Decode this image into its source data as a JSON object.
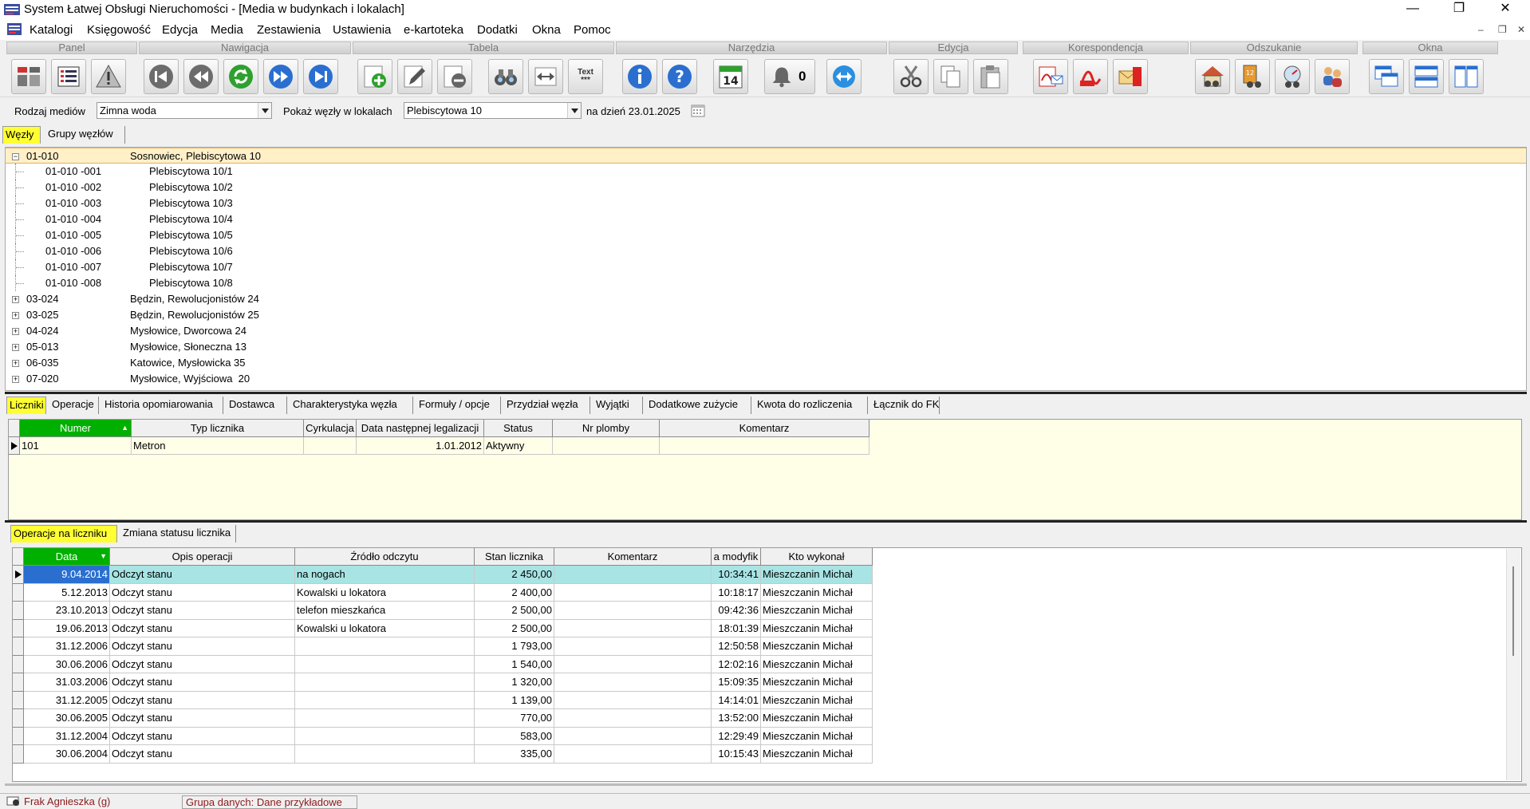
{
  "window": {
    "title": "System Łatwej Obsługi Nieruchomości - [Media w budynkach i lokalach]",
    "minimize": "—",
    "maximize": "❐",
    "close": "✕",
    "mdi_min": "–",
    "mdi_restore": "❐",
    "mdi_close": "✕"
  },
  "menu": [
    "Katalogi",
    "Księgowość",
    "Edycja",
    "Media",
    "Zestawienia",
    "Ustawienia",
    "e-kartoteka",
    "Dodatki",
    "Okna",
    "Pomoc"
  ],
  "toolbar": {
    "groups": [
      "Panel",
      "Nawigacja",
      "Tabela",
      "Narzędzia",
      "Edycja",
      "Korespondencja",
      "Odszukanie",
      "Okna"
    ],
    "text_button_label": "Text",
    "text_button_sub": "***",
    "calendar_day": "14",
    "bell_count": "0"
  },
  "filter": {
    "media_label": "Rodzaj mediów",
    "media_value": "Zimna woda",
    "show_label": "Pokaż węzły w lokalach",
    "show_value": "Plebiscytowa 10",
    "date_label": "na dzień 23.01.2025"
  },
  "tree_tabs": [
    "Węzły",
    "Grupy węzłów"
  ],
  "tree": [
    {
      "code": "01-010",
      "name": "Sosnowiec, Plebiscytowa 10",
      "level": 0,
      "expander": "−",
      "selected": true
    },
    {
      "code": "01-010 -001",
      "name": "Plebiscytowa 10/1",
      "level": 1
    },
    {
      "code": "01-010 -002",
      "name": "Plebiscytowa 10/2",
      "level": 1
    },
    {
      "code": "01-010 -003",
      "name": "Plebiscytowa 10/3",
      "level": 1
    },
    {
      "code": "01-010 -004",
      "name": "Plebiscytowa 10/4",
      "level": 1
    },
    {
      "code": "01-010 -005",
      "name": "Plebiscytowa 10/5",
      "level": 1
    },
    {
      "code": "01-010 -006",
      "name": "Plebiscytowa 10/6",
      "level": 1
    },
    {
      "code": "01-010 -007",
      "name": "Plebiscytowa 10/7",
      "level": 1
    },
    {
      "code": "01-010 -008",
      "name": "Plebiscytowa 10/8",
      "level": 1
    },
    {
      "code": "03-024",
      "name": "Będzin, Rewolucjonistów 24",
      "level": 0,
      "expander": "+"
    },
    {
      "code": "03-025",
      "name": "Będzin, Rewolucjonistów 25",
      "level": 0,
      "expander": "+"
    },
    {
      "code": "04-024",
      "name": "Mysłowice, Dworcowa 24",
      "level": 0,
      "expander": "+"
    },
    {
      "code": "05-013",
      "name": "Mysłowice, Słoneczna 13",
      "level": 0,
      "expander": "+"
    },
    {
      "code": "06-035",
      "name": "Katowice, Mysłowicka 35",
      "level": 0,
      "expander": "+"
    },
    {
      "code": "07-020",
      "name": "Mysłowice, Wyjściowa  20",
      "level": 0,
      "expander": "+"
    }
  ],
  "detail_tabs": [
    "Liczniki",
    "Operacje",
    "Historia opomiarowania",
    "Dostawca",
    "Charakterystyka węzła",
    "Formuły / opcje",
    "Przydział węzła",
    "Wyjątki",
    "Dodatkowe zużycie",
    "Kwota do rozliczenia",
    "Łącznik do FK"
  ],
  "meters": {
    "columns": [
      "Numer",
      "Typ licznika",
      "Cyrkulacja",
      "Data następnej legalizacji",
      "Status",
      "Nr plomby",
      "Komentarz"
    ],
    "sort_arrow": "▲",
    "rows": [
      [
        "101",
        "Metron",
        "",
        "1.01.2012",
        "Aktywny",
        "",
        ""
      ]
    ]
  },
  "ops_tabs": [
    "Operacje na liczniku",
    "Zmiana statusu licznika"
  ],
  "operations": {
    "columns": [
      "Data",
      "Opis operacji",
      "Źródło odczytu",
      "Stan licznika",
      "Komentarz",
      "a modyfik",
      "Kto wykonał"
    ],
    "sort_arrow": "▼",
    "rows": [
      [
        "9.04.2014",
        "Odczyt stanu",
        "na nogach",
        "2 450,00",
        "",
        "10:34:41",
        "Mieszczanin Michał"
      ],
      [
        "5.12.2013",
        "Odczyt stanu",
        "Kowalski u lokatora",
        "2 400,00",
        "",
        "10:18:17",
        "Mieszczanin Michał"
      ],
      [
        "23.10.2013",
        "Odczyt stanu",
        "telefon mieszkańca",
        "2 500,00",
        "",
        "09:42:36",
        "Mieszczanin Michał"
      ],
      [
        "19.06.2013",
        "Odczyt stanu",
        "Kowalski u lokatora",
        "2 500,00",
        "",
        "18:01:39",
        "Mieszczanin Michał"
      ],
      [
        "31.12.2006",
        "Odczyt stanu",
        "",
        "1 793,00",
        "",
        "12:50:58",
        "Mieszczanin Michał"
      ],
      [
        "30.06.2006",
        "Odczyt stanu",
        "",
        "1 540,00",
        "",
        "12:02:16",
        "Mieszczanin Michał"
      ],
      [
        "31.03.2006",
        "Odczyt stanu",
        "",
        "1 320,00",
        "",
        "15:09:35",
        "Mieszczanin Michał"
      ],
      [
        "31.12.2005",
        "Odczyt stanu",
        "",
        "1 139,00",
        "",
        "14:14:01",
        "Mieszczanin Michał"
      ],
      [
        "30.06.2005",
        "Odczyt stanu",
        "",
        "770,00",
        "",
        "13:52:00",
        "Mieszczanin Michał"
      ],
      [
        "31.12.2004",
        "Odczyt stanu",
        "",
        "583,00",
        "",
        "12:29:49",
        "Mieszczanin Michał"
      ],
      [
        "30.06.2004",
        "Odczyt stanu",
        "",
        "335,00",
        "",
        "10:15:43",
        "Mieszczanin Michał"
      ]
    ]
  },
  "status": {
    "user": "Frak Agnieszka (g)",
    "group": "Grupa danych: Dane przykładowe"
  }
}
